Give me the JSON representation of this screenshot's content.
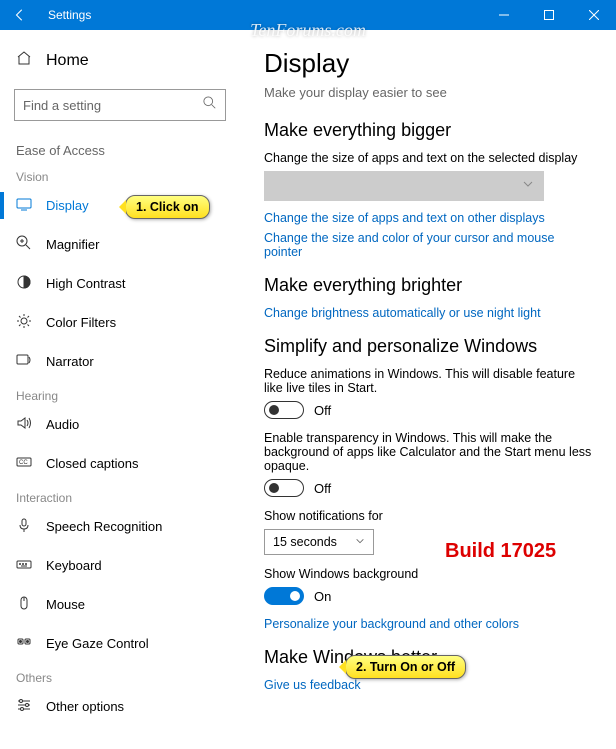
{
  "watermark": "TenForums.com",
  "titlebar": {
    "title": "Settings"
  },
  "sidebar": {
    "home": "Home",
    "search_placeholder": "Find a setting",
    "group": "Ease of Access",
    "sections": {
      "vision": "Vision",
      "hearing": "Hearing",
      "interaction": "Interaction",
      "others": "Others"
    },
    "items": {
      "display": "Display",
      "magnifier": "Magnifier",
      "high_contrast": "High Contrast",
      "color_filters": "Color Filters",
      "narrator": "Narrator",
      "audio": "Audio",
      "closed_captions": "Closed captions",
      "speech": "Speech Recognition",
      "keyboard": "Keyboard",
      "mouse": "Mouse",
      "eye_gaze": "Eye Gaze Control",
      "other_options": "Other options"
    }
  },
  "main": {
    "title": "Display",
    "subtitle": "Make your display easier to see",
    "bigger": {
      "heading": "Make everything bigger",
      "desc": "Change the size of apps and text on the selected display",
      "link1": "Change the size of apps and text on other displays",
      "link2": "Change the size and color of your cursor and mouse pointer"
    },
    "brighter": {
      "heading": "Make everything brighter",
      "link": "Change brightness automatically or use night light"
    },
    "simplify": {
      "heading": "Simplify and personalize Windows",
      "anim_desc": "Reduce animations in Windows.  This will disable feature like live tiles in Start.",
      "anim_state": "Off",
      "trans_desc": "Enable transparency in Windows.  This will make the background of apps like Calculator and the Start menu less opaque.",
      "trans_state": "Off",
      "notif_label": "Show notifications for",
      "notif_value": "15 seconds",
      "bg_label": "Show Windows background",
      "bg_state": "On",
      "personalize_link": "Personalize your background and other colors"
    },
    "better": {
      "heading": "Make Windows better",
      "feedback_link": "Give us feedback"
    }
  },
  "annotations": {
    "callout1": "1. Click on",
    "callout2": "2. Turn On or Off",
    "build": "Build 17025"
  }
}
